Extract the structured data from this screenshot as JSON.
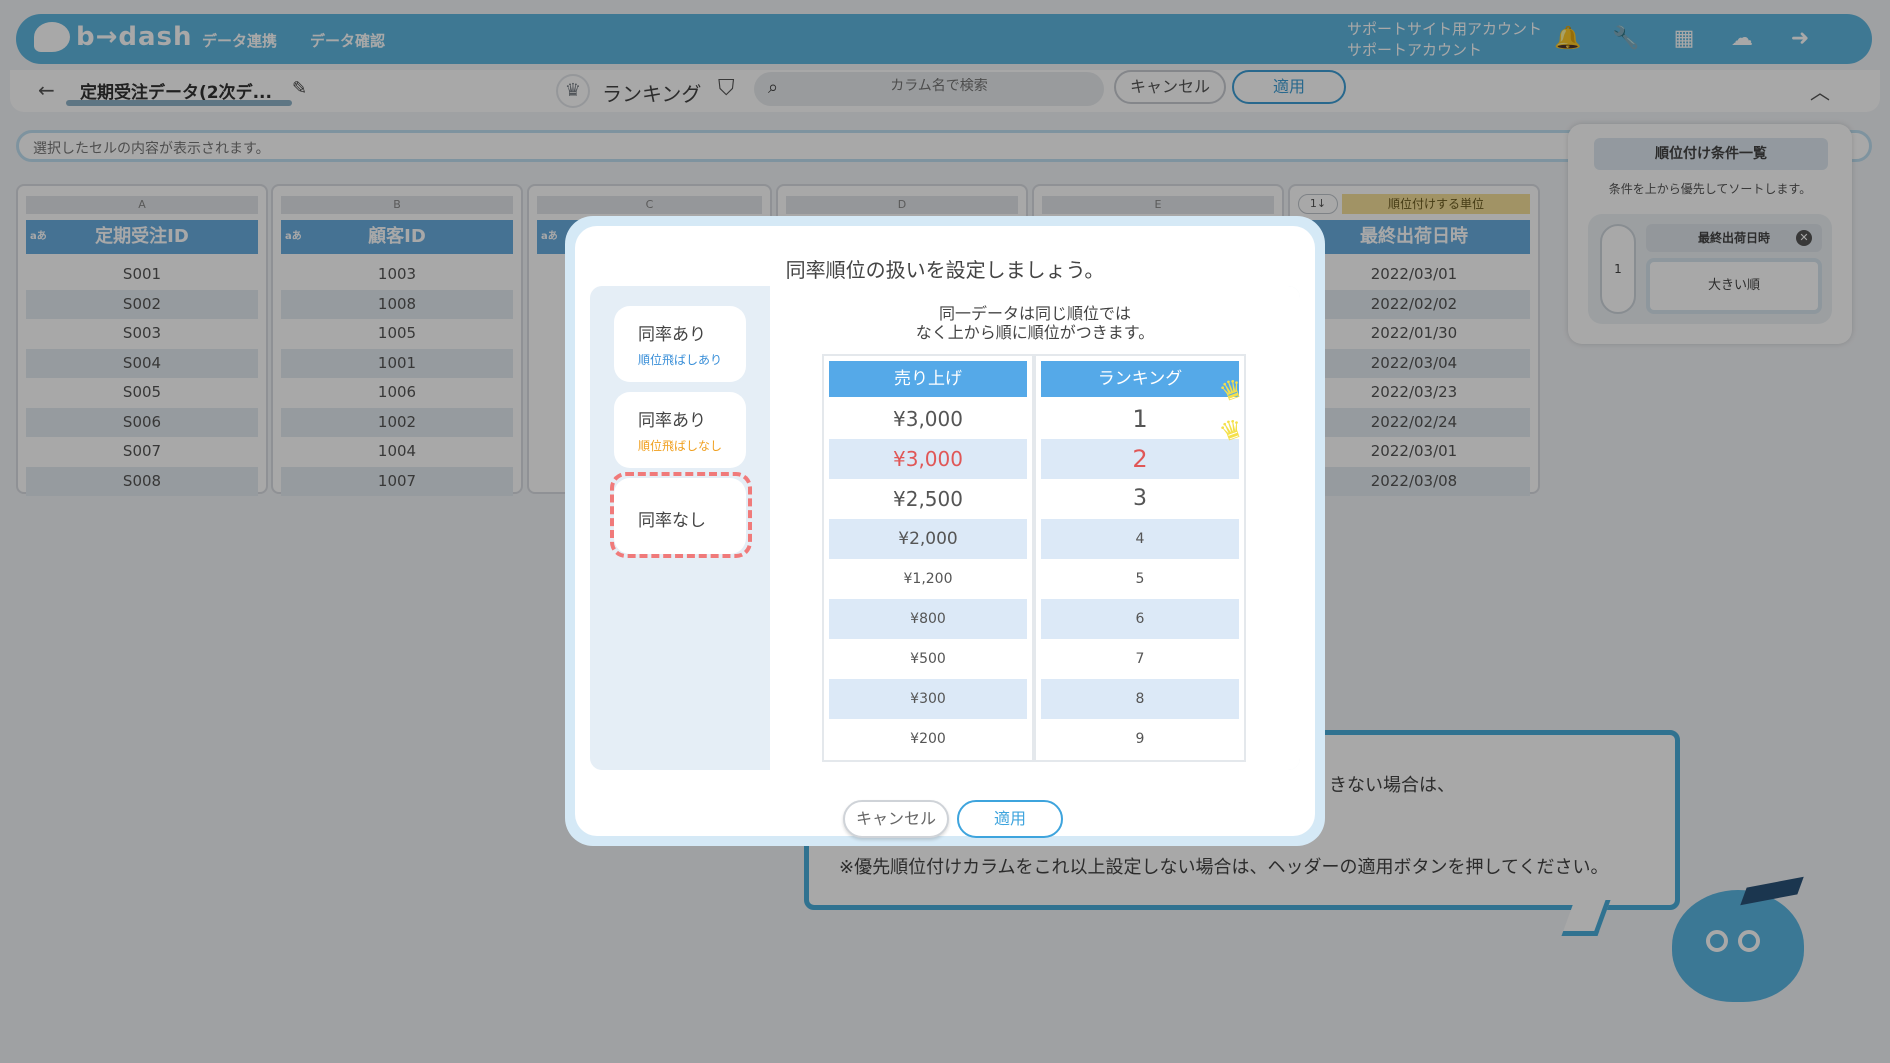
{
  "header": {
    "logo_text": "b→dash",
    "nav": [
      "データ連携",
      "データ確認"
    ],
    "account_line1": "サポートサイト用アカウント",
    "account_line2": "サポートアカウント",
    "icons": [
      "bell-icon",
      "wrench-icon",
      "grid-icon",
      "brain-icon",
      "logout-icon"
    ]
  },
  "subbar": {
    "tab_title": "定期受注データ(2次デ...",
    "mode_label": "ランキング",
    "search_placeholder": "カラム名で検索",
    "cancel_label": "キャンセル",
    "apply_label": "適用"
  },
  "cell_display": {
    "placeholder": "選択したセルの内容が表示されます。"
  },
  "conditions": {
    "title": "順位付け条件一覧",
    "desc": "条件を上から優先してソートします。",
    "number": "1",
    "column": "最終出荷日時",
    "order": "大きい順"
  },
  "grid": {
    "columns": [
      {
        "letter": "A",
        "type": "aあ",
        "header": "定期受注ID",
        "cells": [
          "S001",
          "S002",
          "S003",
          "S004",
          "S005",
          "S006",
          "S007",
          "S008"
        ]
      },
      {
        "letter": "B",
        "type": "aあ",
        "header": "顧客ID",
        "cells": [
          "1003",
          "1008",
          "1005",
          "1001",
          "1006",
          "1002",
          "1004",
          "1007"
        ]
      },
      {
        "letter": "C",
        "type": "aあ",
        "header": "",
        "cells": [
          "",
          "",
          "",
          "",
          "",
          "",
          "",
          ""
        ]
      },
      {
        "letter": "D",
        "type": "",
        "header": "",
        "cells": [
          "",
          "",
          "",
          "",
          "",
          "",
          "",
          ""
        ]
      },
      {
        "letter": "E",
        "type": "",
        "header": "",
        "cells": [
          "",
          "",
          "",
          "",
          "",
          "",
          "",
          ""
        ]
      },
      {
        "sort_label": "1↓",
        "rank_unit": "順位付けする単位",
        "header": "最終出荷日時",
        "cells": [
          "2022/03/01",
          "2022/02/02",
          "2022/01/30",
          "2022/03/04",
          "2022/03/23",
          "2022/02/24",
          "2022/03/01",
          "2022/03/08"
        ]
      }
    ]
  },
  "tip": {
    "line1": "きない場合は、",
    "line2": "※優先順位付けカラムをこれ以上設定しない場合は、ヘッダーの適用ボタンを押してください。"
  },
  "modal": {
    "title": "同率順位の扱いを設定しましょう。",
    "options": [
      {
        "title": "同率あり",
        "sub": "順位飛ばしあり",
        "sub_color": "#3a8fd8"
      },
      {
        "title": "同率あり",
        "sub": "順位飛ばしなし",
        "sub_color": "#f0a020"
      },
      {
        "title": "同率なし",
        "sub": ""
      }
    ],
    "explain_line1": "同一データは同じ順位では",
    "explain_line2": "なく上から順に順位がつきます。",
    "sales_header": "売り上げ",
    "rank_header": "ランキング",
    "sales": [
      "¥3,000",
      "¥3,000",
      "¥2,500",
      "¥2,000",
      "¥1,200",
      "¥800",
      "¥500",
      "¥300",
      "¥200"
    ],
    "ranks": [
      "1",
      "2",
      "3",
      "4",
      "5",
      "6",
      "7",
      "8",
      "9"
    ],
    "highlight_color": "#e05757",
    "cancel_label": "キャンセル",
    "apply_label": "適用"
  }
}
